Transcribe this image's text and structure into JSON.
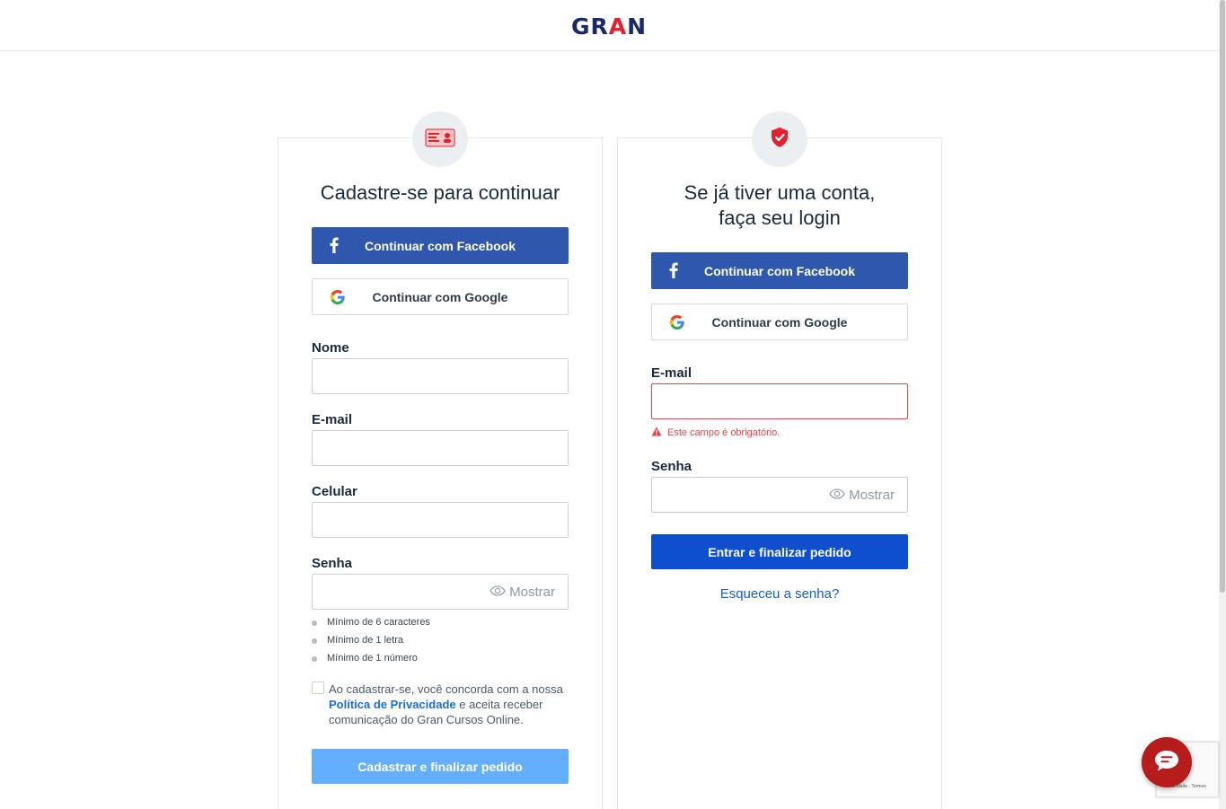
{
  "header": {
    "logo_text_1": "GR",
    "logo_text_2": "A",
    "logo_text_3": "N"
  },
  "signup": {
    "heading": "Cadastre-se para continuar",
    "facebook_label": "Continuar com Facebook",
    "google_label": "Continuar com Google",
    "name_label": "Nome",
    "email_label": "E-mail",
    "phone_label": "Celular",
    "password_label": "Senha",
    "show_label": "Mostrar",
    "rules": [
      "Mínimo de 6 caracteres",
      "Mínimo de 1 letra",
      "Mínimo de 1 número"
    ],
    "consent_text_1": "Ao cadastrar-se, você concorda com a nossa",
    "consent_link": "Política de Privacidade",
    "consent_text_2": "e aceita receber comunicação do Gran Cursos Online.",
    "submit_label": "Cadastrar e finalizar pedido"
  },
  "login": {
    "heading_line1": "Se já tiver uma conta,",
    "heading_line2": "faça seu login",
    "facebook_label": "Continuar com Facebook",
    "google_label": "Continuar com Google",
    "email_label": "E-mail",
    "email_error": "Este campo é obrigatório.",
    "password_label": "Senha",
    "show_label": "Mostrar",
    "submit_label": "Entrar e finalizar pedido",
    "forgot_label": "Esqueceu a senha?"
  },
  "widgets": {
    "recaptcha_text": "Privacidade - Termos"
  },
  "colors": {
    "facebook": "#2e57ad",
    "primary": "#0d4fcf",
    "disabled": "#63aefd",
    "error": "#e5444a",
    "brand_red": "#e5202e",
    "brand_navy": "#1a2a66"
  }
}
